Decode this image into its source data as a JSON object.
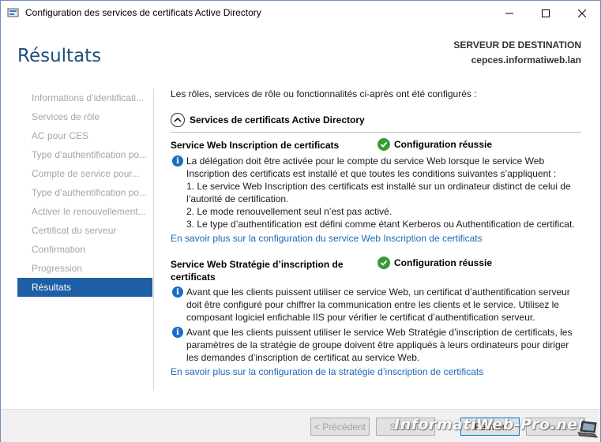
{
  "window": {
    "title": "Configuration des services de certificats Active Directory"
  },
  "header": {
    "page_title": "Résultats",
    "destination_label": "SERVEUR DE DESTINATION",
    "destination_server": "cepces.informatiweb.lan"
  },
  "nav": {
    "items": [
      {
        "label": "Informations d’identificati..."
      },
      {
        "label": "Services de rôle"
      },
      {
        "label": "AC pour CES"
      },
      {
        "label": "Type d’authentification po..."
      },
      {
        "label": "Compte de service pour..."
      },
      {
        "label": "Type d’authentification po..."
      },
      {
        "label": "Activer le renouvellement..."
      },
      {
        "label": "Certificat du serveur"
      },
      {
        "label": "Confirmation"
      },
      {
        "label": "Progression"
      },
      {
        "label": "Résultats"
      }
    ],
    "active_index": 10
  },
  "main": {
    "intro": "Les rôles, services de rôle ou fonctionnalités ci-après ont été configurés :",
    "section_title": "Services de certificats Active Directory",
    "ces": {
      "title": "Service Web Inscription de certificats",
      "status": "Configuration réussie",
      "info_lines": [
        "La délégation doit être activée pour le compte du service Web lorsque le service Web",
        "Inscription des certificats est installé et que toutes les conditions suivantes s’appliquent :",
        "1. Le service Web Inscription des certificats est installé sur un ordinateur distinct de celui de",
        "l’autorité de certification.",
        "2. Le mode renouvellement seul n’est pas activé.",
        "3. Le type d’authentification est défini comme étant Kerberos ou Authentification de certificat."
      ],
      "link": "En savoir plus sur la configuration du service Web Inscription de certificats"
    },
    "cep": {
      "title_line1": "Service Web Stratégie d’inscription de",
      "title_line2": "certificats",
      "status": "Configuration réussie",
      "info1_lines": [
        "Avant que les clients puissent utiliser ce service Web, un certificat d’authentification serveur",
        "doit être configuré pour chiffrer la communication entre les clients et le service. Utilisez le",
        "composant logiciel enfichable IIS pour vérifier le certificat d’authentification serveur."
      ],
      "info2_lines": [
        "Avant que les clients puissent utiliser le service Web Stratégie d’inscription de certificats, les",
        "paramètres de la stratégie de groupe doivent être appliqués à leurs ordinateurs pour diriger",
        "les demandes d’inscription de certificat au service Web."
      ],
      "link": "En savoir plus sur la configuration de la stratégie d’inscription de certificats"
    }
  },
  "footer": {
    "prev_label": "< Précédent",
    "next_label": "Suivant",
    "close_label": "Fermer",
    "cancel_label": "Annuler"
  },
  "watermark": "InformatiWeb-Pro.net"
}
